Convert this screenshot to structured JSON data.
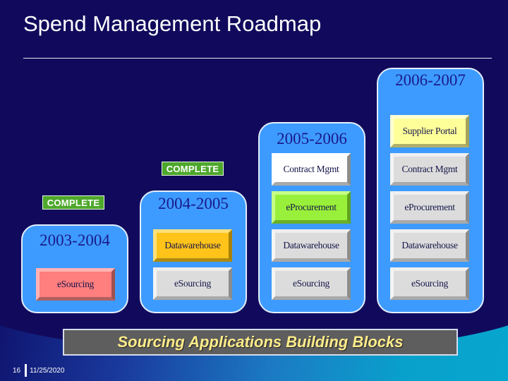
{
  "slide": {
    "title": "Spend Management Roadmap",
    "banner": "Sourcing Applications Building Blocks",
    "footer": {
      "page_number": "16",
      "date": "11/25/2020"
    }
  },
  "status_label": "COMPLETE",
  "columns": [
    {
      "year": "2003-2004",
      "status": "COMPLETE",
      "blocks": [
        {
          "label": "eSourcing",
          "color": "#ff7e7e"
        }
      ]
    },
    {
      "year": "2004-2005",
      "status": "COMPLETE",
      "blocks": [
        {
          "label": "Datawarehouse",
          "color": "#ffc31a"
        },
        {
          "label": "eSourcing",
          "color": "#dcdcdc"
        }
      ]
    },
    {
      "year": "2005-2006",
      "status": "",
      "blocks": [
        {
          "label": "Contract Mgmt",
          "color": "#ffffff"
        },
        {
          "label": "eProcurement",
          "color": "#99f03a"
        },
        {
          "label": "Datawarehouse",
          "color": "#dcdcdc"
        },
        {
          "label": "eSourcing",
          "color": "#dcdcdc"
        }
      ]
    },
    {
      "year": "2006-2007",
      "status": "",
      "blocks": [
        {
          "label": "Supplier Portal",
          "color": "#ffff9a"
        },
        {
          "label": "Contract Mgmt",
          "color": "#dcdcdc"
        },
        {
          "label": "eProcurement",
          "color": "#dcdcdc"
        },
        {
          "label": "Datawarehouse",
          "color": "#dcdcdc"
        },
        {
          "label": "eSourcing",
          "color": "#dcdcdc"
        }
      ]
    }
  ]
}
